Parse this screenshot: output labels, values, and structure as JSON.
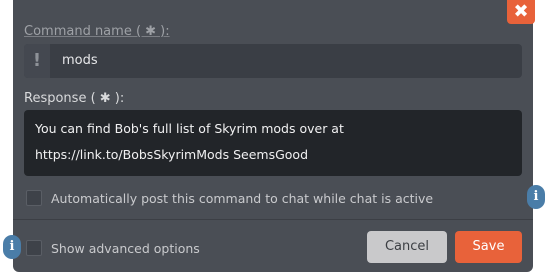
{
  "dialog": {
    "close_glyph": "✖",
    "command_name_label": "Command name ( ✱ ):",
    "command_name_value": "mods",
    "exclaim_glyph": "!",
    "response_label": "Response ( ✱ ):",
    "response_value": "You can find Bob's full list of Skyrim mods over at https://link.to/BobsSkyrimMods SeemsGood",
    "auto_post_label": "Automatically post this command to chat while chat is active",
    "advanced_label": "Show advanced options",
    "info_glyph": "i",
    "cancel_label": "Cancel",
    "save_label": "Save"
  },
  "colors": {
    "background": "#4a4e55",
    "accent": "#e8623a",
    "info": "#4a7da8"
  }
}
